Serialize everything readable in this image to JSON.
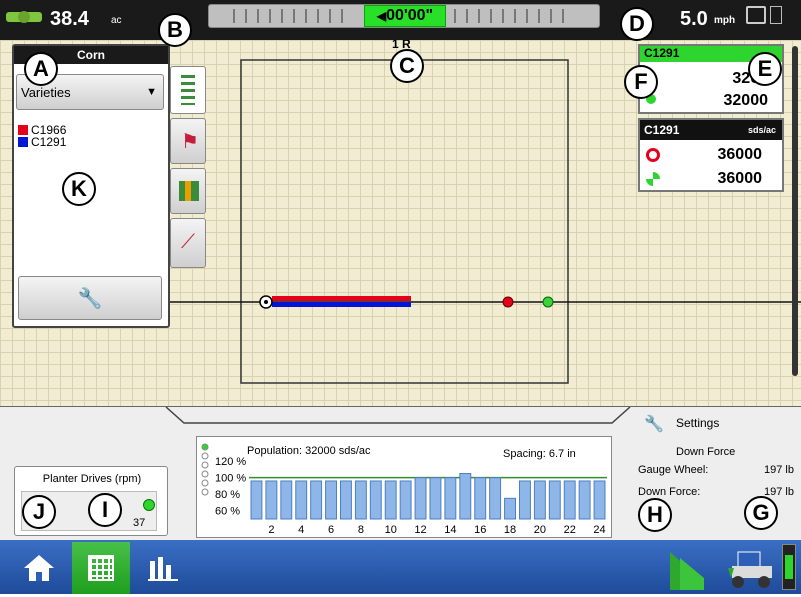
{
  "top": {
    "area_value": "38.4",
    "area_unit": "ac",
    "timer": "00'00\"",
    "speed_value": "5.0",
    "speed_unit": "mph"
  },
  "callouts": {
    "a": "A",
    "b": "B",
    "c": "C",
    "d": "D",
    "e": "E",
    "f": "F",
    "g": "G",
    "h": "H",
    "i": "I",
    "j": "J",
    "k": "K"
  },
  "legend": {
    "title": "Corn",
    "dropdown": "Varieties",
    "items": [
      {
        "label": "C1966",
        "color": "#e3001b"
      },
      {
        "label": "C1291",
        "color": "#0017d6"
      }
    ]
  },
  "map": {
    "row_label": "1 R"
  },
  "rate1": {
    "header": "C1291",
    "value_top": "3200",
    "value_bottom": "32000"
  },
  "rate2": {
    "header": "C1291",
    "unit": "sds/ac",
    "target": "36000",
    "actual": "36000"
  },
  "chart_data": {
    "type": "bar",
    "title": "Population: 32000 sds/ac",
    "annotation": "Spacing: 6.7 in",
    "yticks": [
      "120 %",
      "100 %",
      "80 %",
      "60 %"
    ],
    "ylim": [
      50,
      125
    ],
    "x": [
      1,
      2,
      3,
      4,
      5,
      6,
      7,
      8,
      9,
      10,
      11,
      12,
      13,
      14,
      15,
      16,
      17,
      18,
      19,
      20,
      21,
      22,
      23,
      24
    ],
    "xtick_labels": [
      "2",
      "4",
      "6",
      "8",
      "10",
      "12",
      "14",
      "16",
      "18",
      "20",
      "22",
      "24"
    ],
    "values": [
      96,
      96,
      96,
      96,
      96,
      96,
      96,
      96,
      96,
      96,
      96,
      100,
      100,
      100,
      105,
      100,
      100,
      75,
      96,
      96,
      96,
      96,
      96,
      96
    ]
  },
  "settings": {
    "label": "Settings",
    "section": "Down Force",
    "rows": [
      {
        "name": "Gauge Wheel:",
        "value": "197 lb"
      },
      {
        "name": "Down Force:",
        "value": "197 lb"
      }
    ]
  },
  "planter": {
    "title": "Planter Drives (rpm)",
    "value": "37"
  }
}
